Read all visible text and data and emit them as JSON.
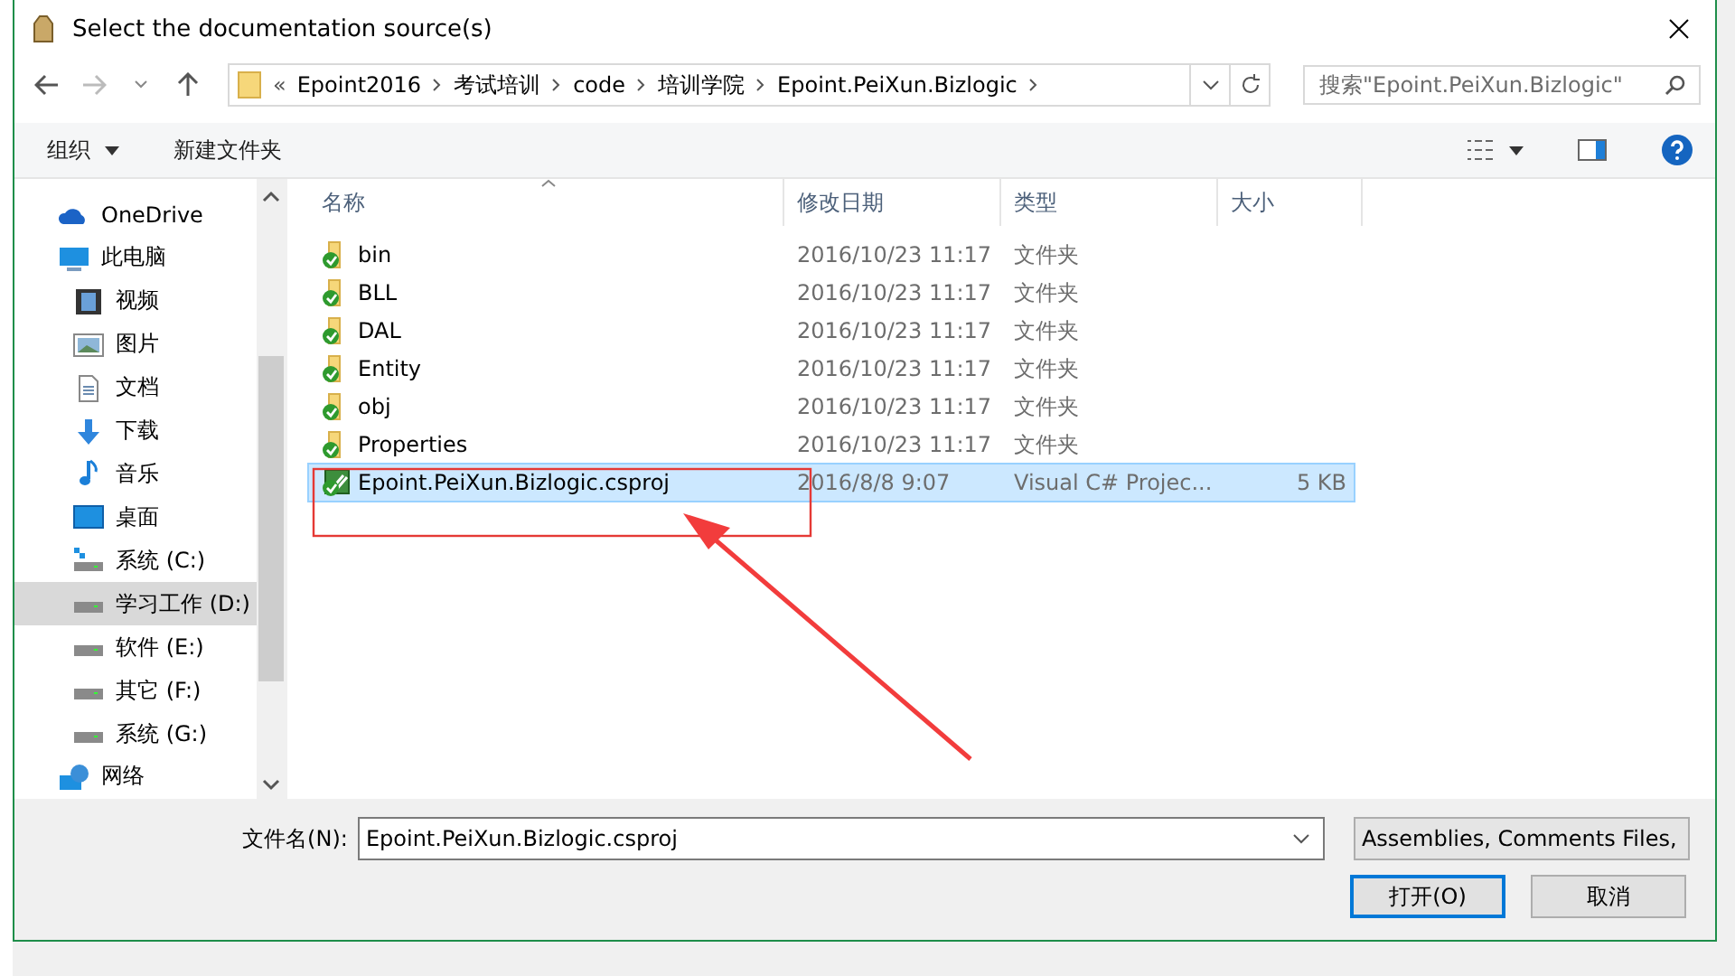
{
  "window": {
    "title": "Select the documentation source(s)"
  },
  "address_bar": {
    "overflow": "«",
    "crumbs": [
      "Epoint2016",
      "考试培训",
      "code",
      "培训学院",
      "Epoint.PeiXun.Bizlogic"
    ]
  },
  "search": {
    "placeholder": "搜索\"Epoint.PeiXun.Bizlogic\""
  },
  "toolbar": {
    "organize": "组织",
    "new_folder": "新建文件夹"
  },
  "nav": [
    {
      "label": "OneDrive",
      "kind": "cloud",
      "selected": false
    },
    {
      "label": "此电脑",
      "kind": "pc",
      "selected": false,
      "children": [
        {
          "label": "视频",
          "kind": "video",
          "selected": false
        },
        {
          "label": "图片",
          "kind": "pictures",
          "selected": false
        },
        {
          "label": "文档",
          "kind": "docs",
          "selected": false
        },
        {
          "label": "下载",
          "kind": "download",
          "selected": false
        },
        {
          "label": "音乐",
          "kind": "music",
          "selected": false
        },
        {
          "label": "桌面",
          "kind": "desktop",
          "selected": false
        },
        {
          "label": "系统 (C:)",
          "kind": "sysdrive",
          "selected": false
        },
        {
          "label": "学习工作 (D:)",
          "kind": "drive",
          "selected": true
        },
        {
          "label": "软件 (E:)",
          "kind": "drive",
          "selected": false
        },
        {
          "label": "其它 (F:)",
          "kind": "drive",
          "selected": false
        },
        {
          "label": "系统 (G:)",
          "kind": "drive",
          "selected": false
        }
      ]
    },
    {
      "label": "网络",
      "kind": "network",
      "selected": false
    }
  ],
  "columns": [
    "名称",
    "修改日期",
    "类型",
    "大小"
  ],
  "rows": [
    {
      "name": "bin",
      "date": "2016/10/23 11:17",
      "type": "文件夹",
      "kind": "folder",
      "selected": false
    },
    {
      "name": "BLL",
      "date": "2016/10/23 11:17",
      "type": "文件夹",
      "kind": "folder",
      "selected": false
    },
    {
      "name": "DAL",
      "date": "2016/10/23 11:17",
      "type": "文件夹",
      "kind": "folder",
      "selected": false
    },
    {
      "name": "Entity",
      "date": "2016/10/23 11:17",
      "type": "文件夹",
      "kind": "folder",
      "selected": false
    },
    {
      "name": "obj",
      "date": "2016/10/23 11:17",
      "type": "文件夹",
      "kind": "folder",
      "selected": false
    },
    {
      "name": "Properties",
      "date": "2016/10/23 11:17",
      "type": "文件夹",
      "kind": "folder",
      "selected": false
    },
    {
      "name": "Epoint.PeiXun.Bizlogic.csproj",
      "date": "2016/8/8 9:07",
      "type": "Visual C# Projec...",
      "size": "5 KB",
      "kind": "project",
      "selected": true
    }
  ],
  "footer": {
    "filename_label": "文件名(N):",
    "filename": "Epoint.PeiXun.Bizlogic.csproj",
    "filter": "Assemblies, Comments Files,",
    "buttons": [
      {
        "label": "打开(O)",
        "default": true
      },
      {
        "label": "取消",
        "default": false
      }
    ]
  }
}
